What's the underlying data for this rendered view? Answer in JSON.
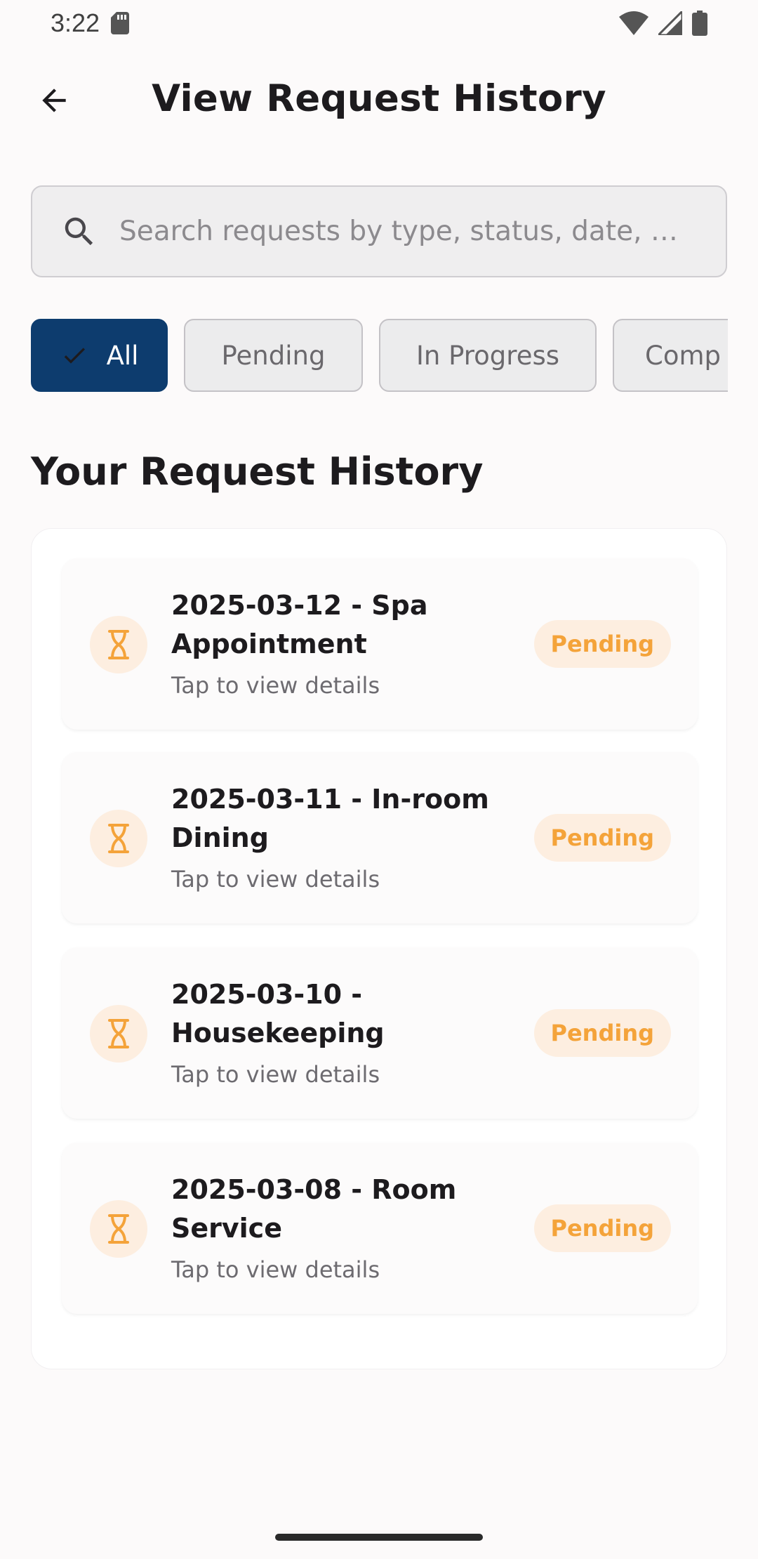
{
  "status_bar": {
    "time": "3:22"
  },
  "header": {
    "title": "View Request History",
    "back_icon": "arrow-left-icon"
  },
  "search": {
    "placeholder": "Search requests by type, status, date, …",
    "value": ""
  },
  "filters": [
    {
      "label": "All",
      "selected": true
    },
    {
      "label": "Pending",
      "selected": false
    },
    {
      "label": "In Progress",
      "selected": false
    },
    {
      "label": "Comp",
      "selected": false
    }
  ],
  "section": {
    "title": "Your Request History"
  },
  "requests": [
    {
      "title": "2025-03-12 - Spa Appointment",
      "subtitle": "Tap to view details",
      "status": "Pending",
      "icon": "hourglass-icon"
    },
    {
      "title": "2025-03-11 - In-room Dining",
      "subtitle": "Tap to view details",
      "status": "Pending",
      "icon": "hourglass-icon"
    },
    {
      "title": "2025-03-10 - Housekeeping",
      "subtitle": "Tap to view details",
      "status": "Pending",
      "icon": "hourglass-icon"
    },
    {
      "title": "2025-03-08 - Room Service",
      "subtitle": "Tap to view details",
      "status": "Pending",
      "icon": "hourglass-icon"
    }
  ],
  "colors": {
    "accent": "#0d3c6e",
    "pending": "#f4a33a",
    "pending_bg": "#fdeee0"
  }
}
